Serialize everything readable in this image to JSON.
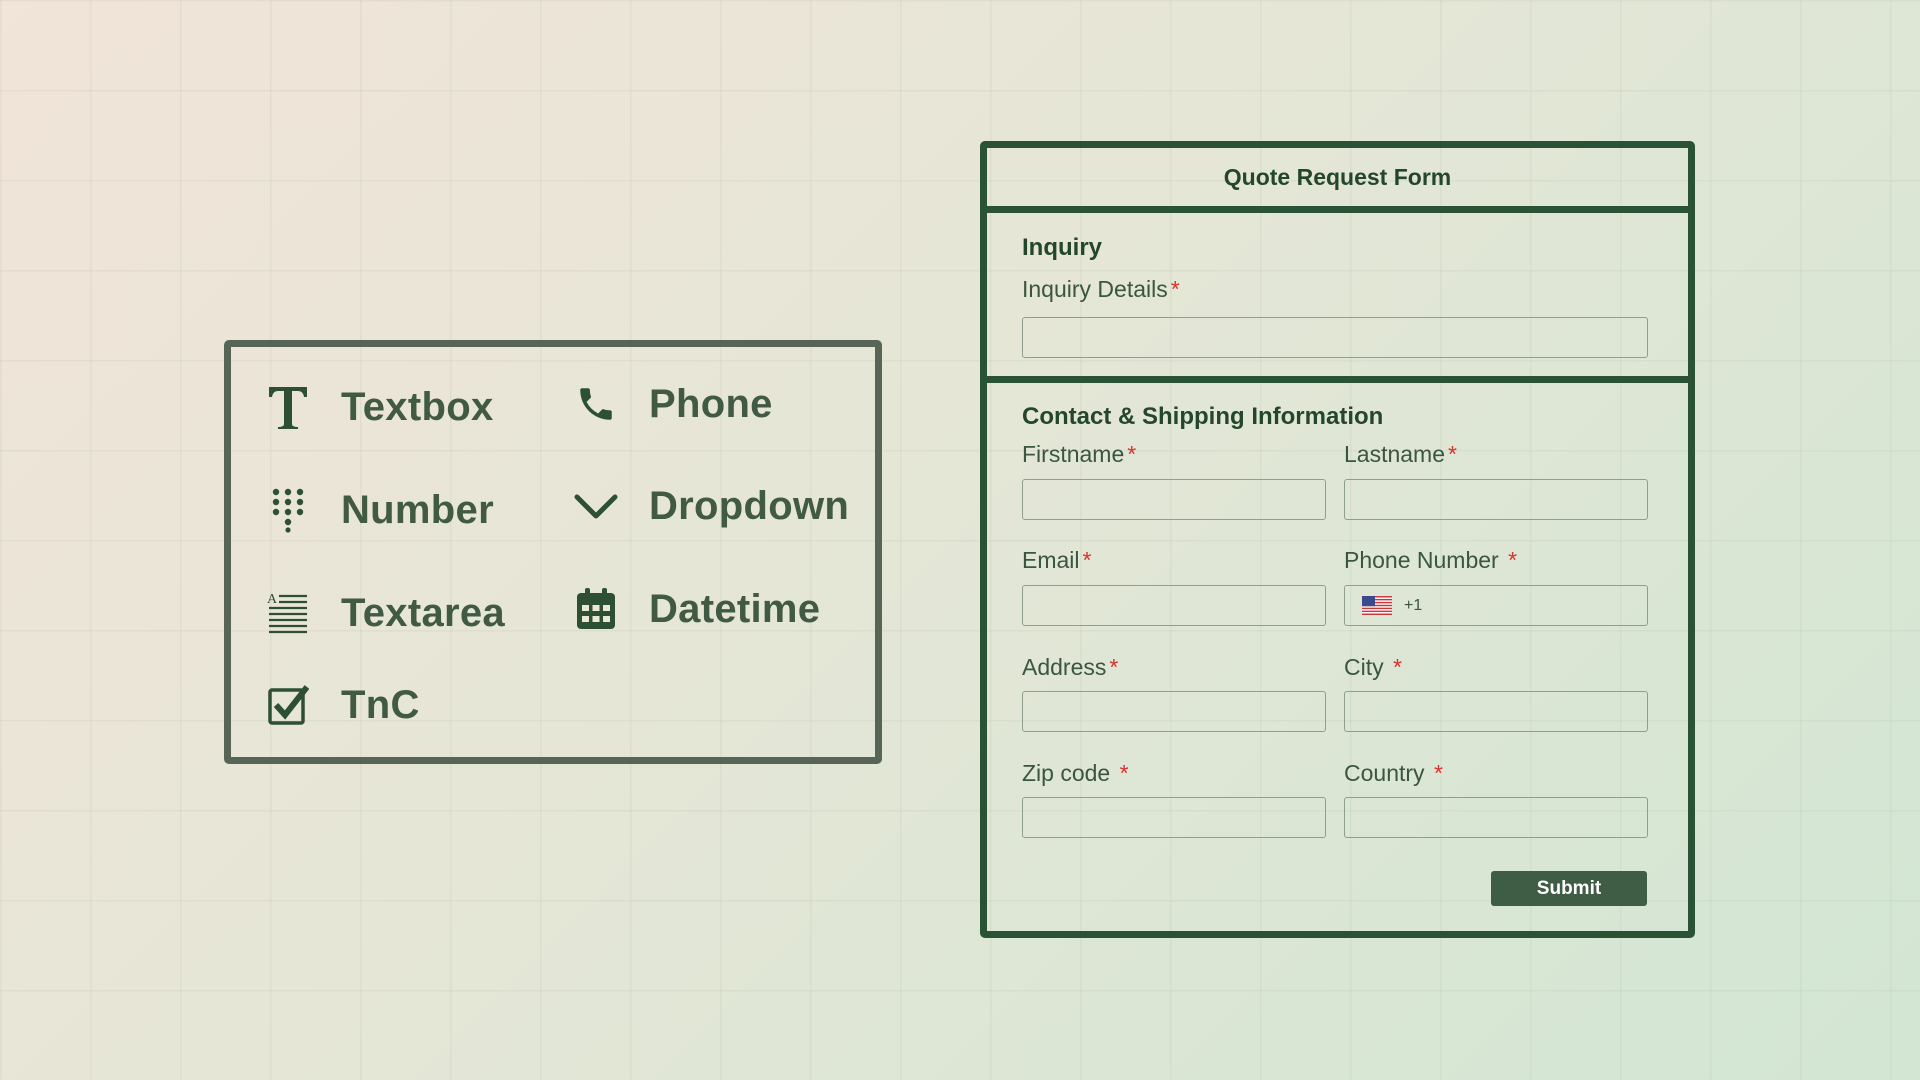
{
  "palette": {
    "items": [
      {
        "label": "Textbox",
        "icon": "text-t-icon"
      },
      {
        "label": "Phone",
        "icon": "phone-icon"
      },
      {
        "label": "Number",
        "icon": "keypad-icon"
      },
      {
        "label": "Dropdown",
        "icon": "chevron-down-icon"
      },
      {
        "label": "Textarea",
        "icon": "textarea-lines-icon"
      },
      {
        "label": "Datetime",
        "icon": "calendar-icon"
      },
      {
        "label": "TnC",
        "icon": "checkbox-checked-icon"
      }
    ]
  },
  "form": {
    "title": "Quote Request Form",
    "sections": {
      "inquiry": {
        "title": "Inquiry",
        "inquiry_details_label": "Inquiry Details"
      },
      "contact": {
        "title": "Contact & Shipping Information",
        "firstname_label": "Firstname",
        "lastname_label": "Lastname",
        "email_label": "Email",
        "phone_label": "Phone Number",
        "phone_dial_code": "+1",
        "phone_flag": "us-flag-icon",
        "address_label": "Address",
        "city_label": "City",
        "zip_label": "Zip code",
        "country_label": "Country"
      }
    },
    "required_marker": "*",
    "submit_label": "Submit"
  },
  "colors": {
    "form_border": "#2a5234",
    "palette_border": "#566556",
    "icon_text": "#405a43",
    "submit_bg": "#3f5d45",
    "required": "#d9312c"
  }
}
